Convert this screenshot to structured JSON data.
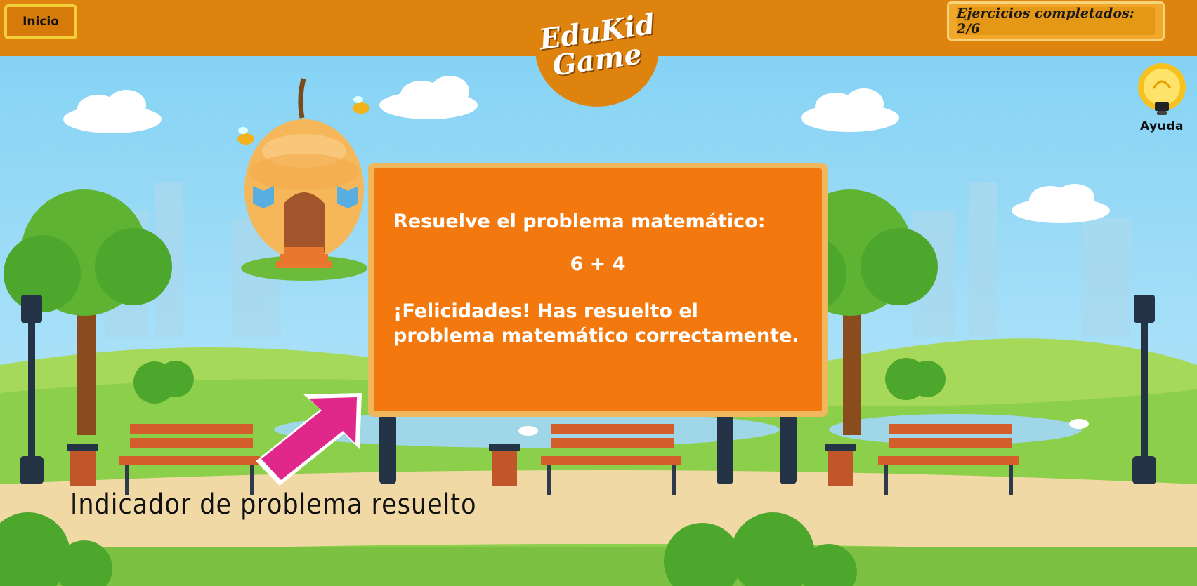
{
  "header": {
    "home_button": "Inicio",
    "progress_text": "Ejercicios completados: 2/6",
    "logo_line1": "EduKid",
    "logo_line2": "Game",
    "help_label": "Ayuda"
  },
  "dialog": {
    "prompt": "Resuelve el problema matemático:",
    "problem": "6 + 4",
    "message": "¡Felicidades! Has resuelto el problema matemático correctamente."
  },
  "annotation": {
    "caption": "Indicador de problema resuelto"
  },
  "colors": {
    "topbar": "#de830e",
    "dialog_fill": "#f3790f",
    "dialog_border": "#f0b85e",
    "arrow": "#e0288a",
    "sky": "#9ad7f2",
    "grass": "#8ccf4a",
    "path": "#f1d9a6"
  },
  "icons": [
    "lightbulb-icon",
    "bee-icon",
    "beehouse-icon",
    "arrow-icon",
    "bench-icon",
    "lamp-icon",
    "trash-bin-icon",
    "tree-icon",
    "cloud-icon",
    "swan-icon"
  ]
}
